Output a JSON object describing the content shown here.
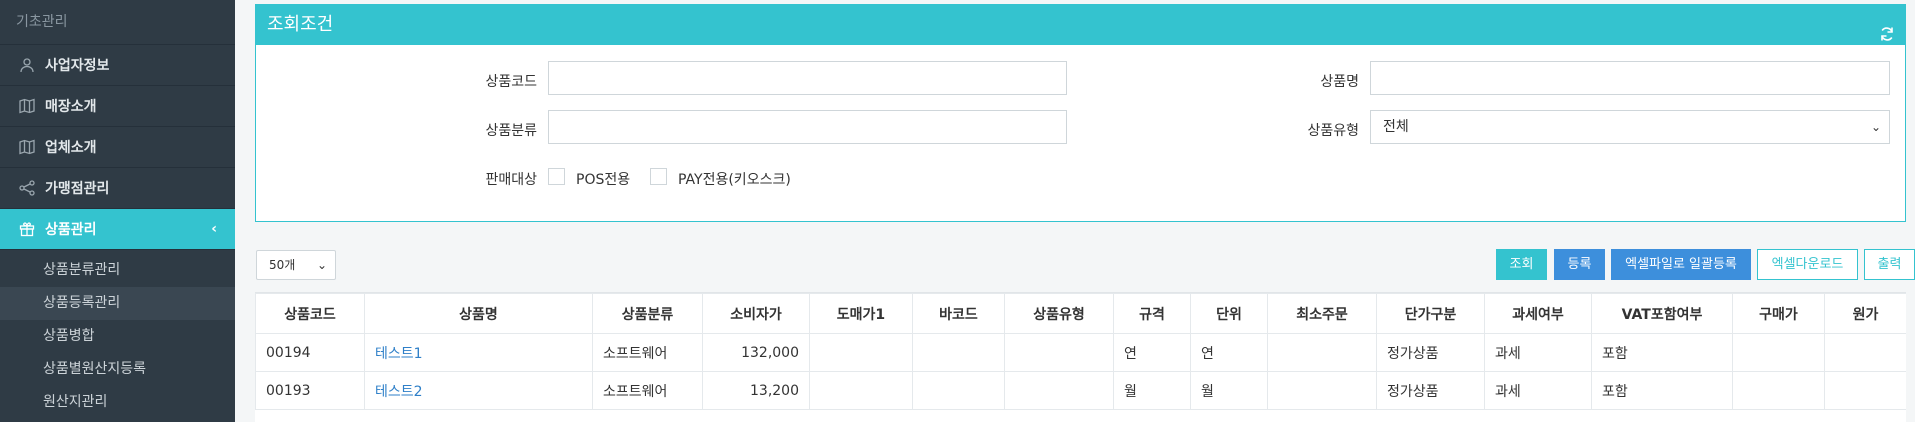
{
  "sidebar": {
    "section_title": "기초관리",
    "items": [
      {
        "label": "사업자정보",
        "icon": "user-icon"
      },
      {
        "label": "매장소개",
        "icon": "map-icon"
      },
      {
        "label": "업체소개",
        "icon": "map-icon"
      },
      {
        "label": "가맹점관리",
        "icon": "share-icon"
      },
      {
        "label": "상품관리",
        "icon": "gift-icon",
        "active": true
      }
    ],
    "sub_items": [
      {
        "label": "상품분류관리"
      },
      {
        "label": "상품등록관리",
        "active": true
      },
      {
        "label": "상품병합"
      },
      {
        "label": "상품별원산지등록"
      },
      {
        "label": "원산지관리"
      }
    ]
  },
  "search_panel": {
    "title": "조회조건",
    "product_code_label": "상품코드",
    "product_name_label": "상품명",
    "product_category_label": "상품분류",
    "product_type_label": "상품유형",
    "product_type_value": "전체",
    "sales_target_label": "판매대상",
    "pos_only_label": "POS전용",
    "pay_only_label": "PAY전용(키오스크)"
  },
  "toolbar": {
    "page_size": "50개",
    "search_button": "조회",
    "register_button": "등록",
    "excel_bulk_button": "엑셀파일로 일괄등록",
    "excel_download_button": "엑셀다운로드",
    "print_button": "출력"
  },
  "table": {
    "headers": [
      "상품코드",
      "상품명",
      "상품분류",
      "소비자가",
      "도매가1",
      "바코드",
      "상품유형",
      "규격",
      "단위",
      "최소주문",
      "단가구분",
      "과세여부",
      "VAT포함여부",
      "구매가",
      "원가"
    ],
    "rows": [
      [
        "00194",
        "테스트1",
        "소프트웨어",
        "132,000",
        "",
        "",
        "",
        "연",
        "연",
        "",
        "정가상품",
        "과세",
        "포함",
        "",
        ""
      ],
      [
        "00193",
        "테스트2",
        "소프트웨어",
        "13,200",
        "",
        "",
        "",
        "월",
        "월",
        "",
        "정가상품",
        "과세",
        "포함",
        "",
        ""
      ]
    ]
  },
  "colors": {
    "accent": "#34c3cf",
    "primary_button": "#3d8fdc",
    "sidebar_bg": "#2f3b45",
    "link": "#2e7fc8"
  }
}
